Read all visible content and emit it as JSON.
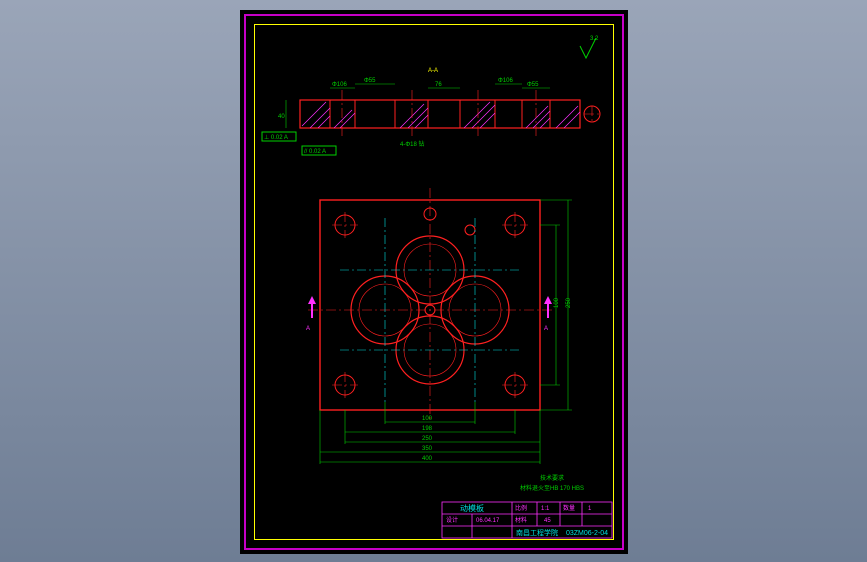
{
  "sheet": {
    "surface_symbol": "√",
    "surface_value": "3.2",
    "section_label": "A-A",
    "note1": "技术要求",
    "note2": "材料退火至HB 170 HBS"
  },
  "top_view": {
    "dims_top": [
      "Φ106",
      "Φ55",
      "76",
      "Φ106",
      "Φ55"
    ],
    "dim_left": "40",
    "gd_box1": "⊥ 0.02 A",
    "gd_box2": "// 0.02 A",
    "callout": "4-Φ18 钻",
    "datum": "A"
  },
  "plan_view": {
    "dim_right_side": [
      "100",
      "250"
    ],
    "dim_bottom": [
      "100",
      "198",
      "250",
      "350",
      "400"
    ],
    "section_mark": "A"
  },
  "title_block": {
    "part_name": "动模板",
    "scale_label": "比例",
    "scale": "1:1",
    "qty_label": "数量",
    "qty": "1",
    "mat_label": "材料",
    "mat": "45",
    "drawn_label": "设计",
    "date": "06.04.17",
    "org": "南昌工程学院",
    "dwg_no": "03ZM06-2-04"
  }
}
